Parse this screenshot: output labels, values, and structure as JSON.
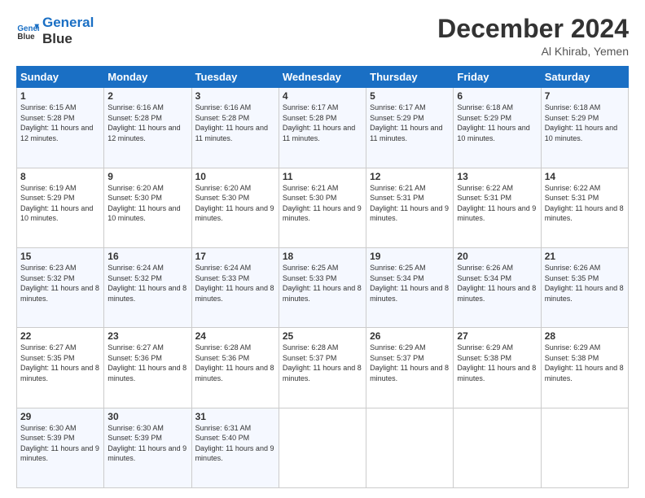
{
  "header": {
    "logo_line1": "General",
    "logo_line2": "Blue",
    "month_title": "December 2024",
    "subtitle": "Al Khirab, Yemen"
  },
  "days_of_week": [
    "Sunday",
    "Monday",
    "Tuesday",
    "Wednesday",
    "Thursday",
    "Friday",
    "Saturday"
  ],
  "weeks": [
    [
      {
        "day": "1",
        "sunrise": "6:15 AM",
        "sunset": "5:28 PM",
        "daylight": "11 hours and 12 minutes."
      },
      {
        "day": "2",
        "sunrise": "6:16 AM",
        "sunset": "5:28 PM",
        "daylight": "11 hours and 12 minutes."
      },
      {
        "day": "3",
        "sunrise": "6:16 AM",
        "sunset": "5:28 PM",
        "daylight": "11 hours and 11 minutes."
      },
      {
        "day": "4",
        "sunrise": "6:17 AM",
        "sunset": "5:28 PM",
        "daylight": "11 hours and 11 minutes."
      },
      {
        "day": "5",
        "sunrise": "6:17 AM",
        "sunset": "5:29 PM",
        "daylight": "11 hours and 11 minutes."
      },
      {
        "day": "6",
        "sunrise": "6:18 AM",
        "sunset": "5:29 PM",
        "daylight": "11 hours and 10 minutes."
      },
      {
        "day": "7",
        "sunrise": "6:18 AM",
        "sunset": "5:29 PM",
        "daylight": "11 hours and 10 minutes."
      }
    ],
    [
      {
        "day": "8",
        "sunrise": "6:19 AM",
        "sunset": "5:29 PM",
        "daylight": "11 hours and 10 minutes."
      },
      {
        "day": "9",
        "sunrise": "6:20 AM",
        "sunset": "5:30 PM",
        "daylight": "11 hours and 10 minutes."
      },
      {
        "day": "10",
        "sunrise": "6:20 AM",
        "sunset": "5:30 PM",
        "daylight": "11 hours and 9 minutes."
      },
      {
        "day": "11",
        "sunrise": "6:21 AM",
        "sunset": "5:30 PM",
        "daylight": "11 hours and 9 minutes."
      },
      {
        "day": "12",
        "sunrise": "6:21 AM",
        "sunset": "5:31 PM",
        "daylight": "11 hours and 9 minutes."
      },
      {
        "day": "13",
        "sunrise": "6:22 AM",
        "sunset": "5:31 PM",
        "daylight": "11 hours and 9 minutes."
      },
      {
        "day": "14",
        "sunrise": "6:22 AM",
        "sunset": "5:31 PM",
        "daylight": "11 hours and 8 minutes."
      }
    ],
    [
      {
        "day": "15",
        "sunrise": "6:23 AM",
        "sunset": "5:32 PM",
        "daylight": "11 hours and 8 minutes."
      },
      {
        "day": "16",
        "sunrise": "6:24 AM",
        "sunset": "5:32 PM",
        "daylight": "11 hours and 8 minutes."
      },
      {
        "day": "17",
        "sunrise": "6:24 AM",
        "sunset": "5:33 PM",
        "daylight": "11 hours and 8 minutes."
      },
      {
        "day": "18",
        "sunrise": "6:25 AM",
        "sunset": "5:33 PM",
        "daylight": "11 hours and 8 minutes."
      },
      {
        "day": "19",
        "sunrise": "6:25 AM",
        "sunset": "5:34 PM",
        "daylight": "11 hours and 8 minutes."
      },
      {
        "day": "20",
        "sunrise": "6:26 AM",
        "sunset": "5:34 PM",
        "daylight": "11 hours and 8 minutes."
      },
      {
        "day": "21",
        "sunrise": "6:26 AM",
        "sunset": "5:35 PM",
        "daylight": "11 hours and 8 minutes."
      }
    ],
    [
      {
        "day": "22",
        "sunrise": "6:27 AM",
        "sunset": "5:35 PM",
        "daylight": "11 hours and 8 minutes."
      },
      {
        "day": "23",
        "sunrise": "6:27 AM",
        "sunset": "5:36 PM",
        "daylight": "11 hours and 8 minutes."
      },
      {
        "day": "24",
        "sunrise": "6:28 AM",
        "sunset": "5:36 PM",
        "daylight": "11 hours and 8 minutes."
      },
      {
        "day": "25",
        "sunrise": "6:28 AM",
        "sunset": "5:37 PM",
        "daylight": "11 hours and 8 minutes."
      },
      {
        "day": "26",
        "sunrise": "6:29 AM",
        "sunset": "5:37 PM",
        "daylight": "11 hours and 8 minutes."
      },
      {
        "day": "27",
        "sunrise": "6:29 AM",
        "sunset": "5:38 PM",
        "daylight": "11 hours and 8 minutes."
      },
      {
        "day": "28",
        "sunrise": "6:29 AM",
        "sunset": "5:38 PM",
        "daylight": "11 hours and 8 minutes."
      }
    ],
    [
      {
        "day": "29",
        "sunrise": "6:30 AM",
        "sunset": "5:39 PM",
        "daylight": "11 hours and 9 minutes."
      },
      {
        "day": "30",
        "sunrise": "6:30 AM",
        "sunset": "5:39 PM",
        "daylight": "11 hours and 9 minutes."
      },
      {
        "day": "31",
        "sunrise": "6:31 AM",
        "sunset": "5:40 PM",
        "daylight": "11 hours and 9 minutes."
      },
      null,
      null,
      null,
      null
    ]
  ]
}
